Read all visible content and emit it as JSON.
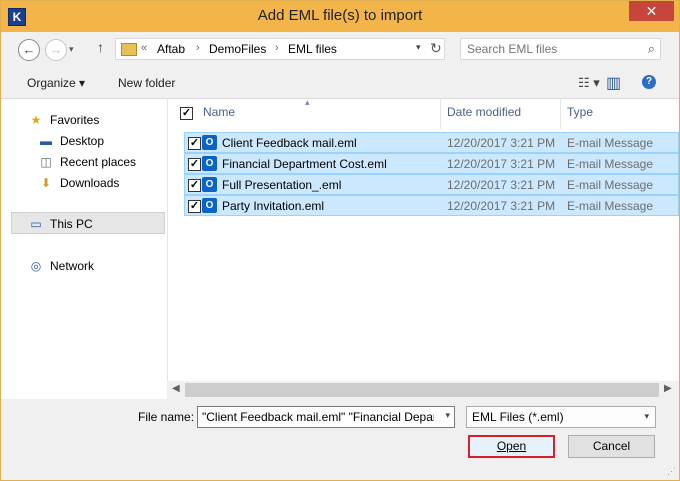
{
  "window": {
    "title": "Add EML file(s) to import",
    "app_icon_letter": "K",
    "close_glyph": "✕"
  },
  "navbar": {
    "back_glyph": "←",
    "forward_glyph": "→",
    "recent_glyph": "▾",
    "up_glyph": "↑",
    "breadcrumb_prefix": "«",
    "breadcrumbs": [
      "Aftab",
      "DemoFiles",
      "EML files"
    ],
    "breadcrumb_sep": "›",
    "address_dropdown_glyph": "▾",
    "refresh_glyph": "↻",
    "search_placeholder": "Search EML files",
    "search_glyph": "⌕"
  },
  "toolbar": {
    "organize_label": "Organize ▾",
    "new_folder_label": "New folder",
    "view_glyph": "☷ ▾",
    "pane_glyph": "▥",
    "help_glyph": "?"
  },
  "nav_pane": {
    "favorites": {
      "label": "Favorites",
      "icon": "star-icon",
      "glyph": "★"
    },
    "favorite_items": [
      {
        "label": "Desktop",
        "icon": "desktop-icon",
        "glyph": "▬"
      },
      {
        "label": "Recent places",
        "icon": "recent-places-icon",
        "glyph": "◫"
      },
      {
        "label": "Downloads",
        "icon": "downloads-icon",
        "glyph": "⬇"
      }
    ],
    "this_pc": {
      "label": "This PC",
      "icon": "computer-icon",
      "glyph": "▭"
    },
    "network": {
      "label": "Network",
      "icon": "network-icon",
      "glyph": "◎"
    }
  },
  "file_list": {
    "columns": [
      "Name",
      "Date modified",
      "Type"
    ],
    "sort_glyph": "▴",
    "check_glyph": "✓",
    "file_icon_letter": "O",
    "rows": [
      {
        "name": "Client Feedback mail.eml",
        "date": "12/20/2017 3:21 PM",
        "type": "E-mail Message"
      },
      {
        "name": "Financial Department Cost.eml",
        "date": "12/20/2017 3:21 PM",
        "type": "E-mail Message"
      },
      {
        "name": "Full Presentation_.eml",
        "date": "12/20/2017 3:21 PM",
        "type": "E-mail Message"
      },
      {
        "name": "Party Invitation.eml",
        "date": "12/20/2017 3:21 PM",
        "type": "E-mail Message"
      }
    ],
    "scroll_left_glyph": "◀",
    "scroll_right_glyph": "▶"
  },
  "bottom": {
    "file_name_label": "File name:",
    "file_name_value": "\"Client Feedback mail.eml\" \"Financial Depart",
    "file_name_dd_glyph": "▾",
    "filter_value": "EML Files (*.eml)",
    "filter_dd_glyph": "▾",
    "open_label": "Open",
    "cancel_label": "Cancel",
    "grip_glyph": "⋰"
  }
}
